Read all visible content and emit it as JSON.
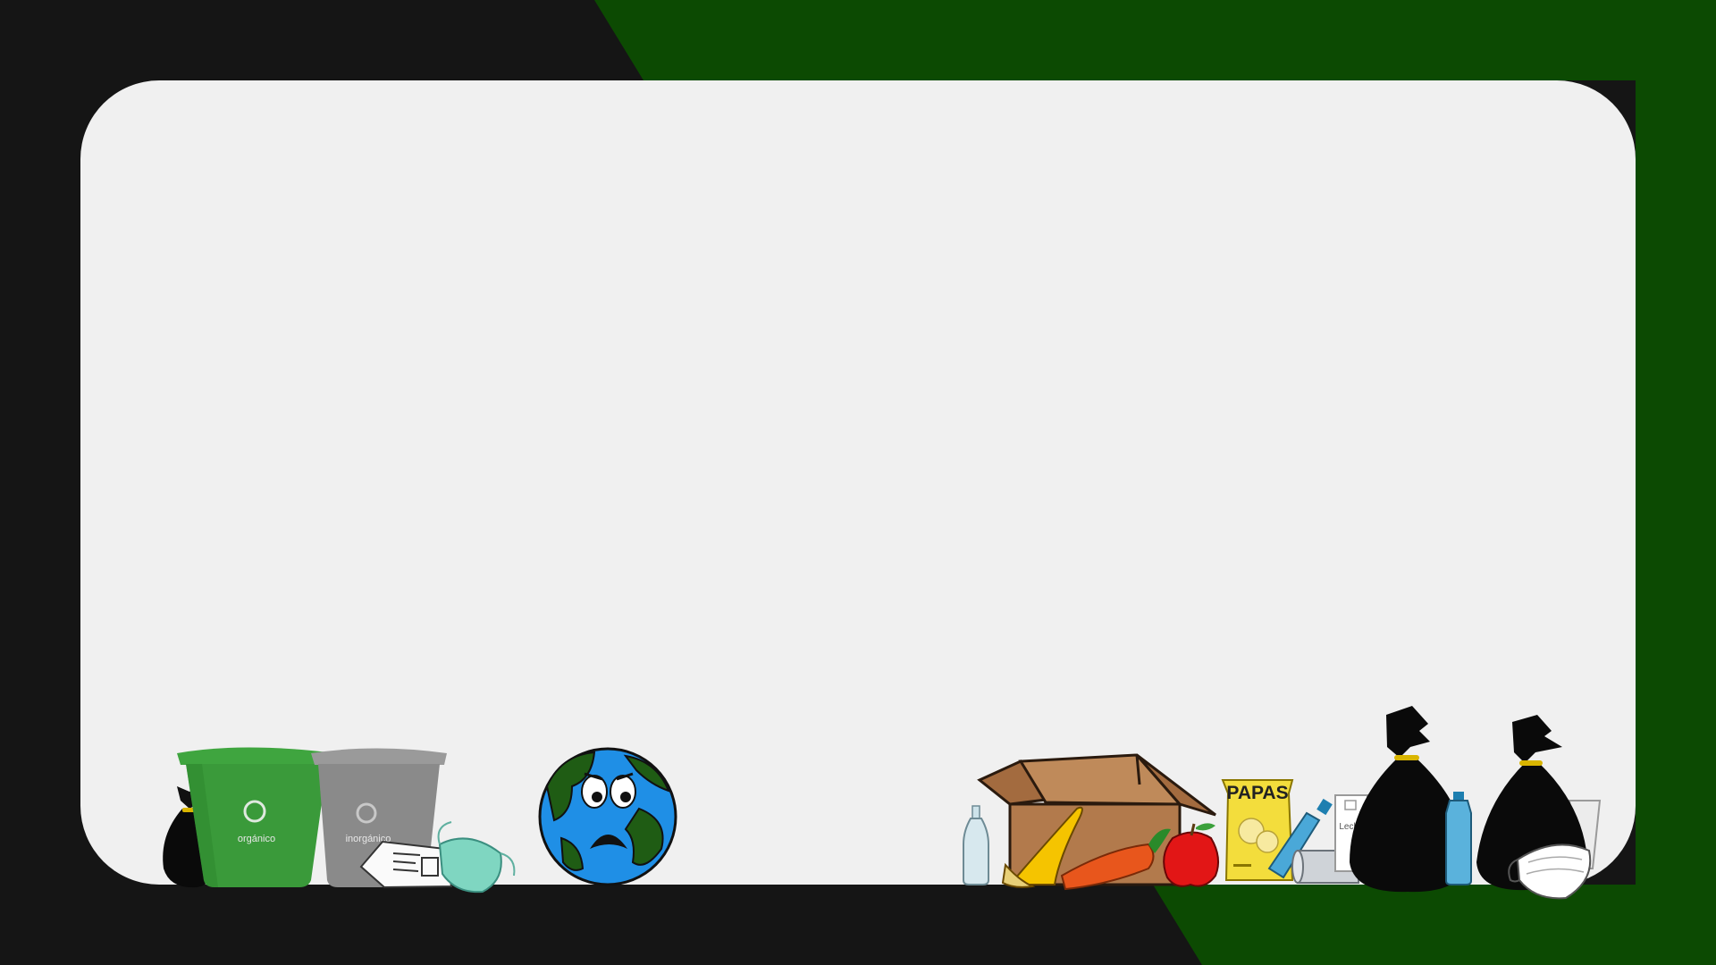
{
  "colors": {
    "background_dark": "#151515",
    "background_green": "#0c4a02",
    "panel": "#f0f0f0",
    "bin_green": "#3a9a3a",
    "bin_gray": "#8a8a8a",
    "earth_ocean": "#1f8fe6",
    "earth_land": "#1f5c14",
    "papas_yellow": "#f3dd3c"
  },
  "labels": {
    "bin_green": "orgánico",
    "bin_gray": "inorgánico",
    "chips_bag": "PAPAS",
    "milk_carton": "Leche"
  },
  "icons": [
    "garbage-bag-icon",
    "green-bin-icon",
    "gray-bin-icon",
    "newspaper-icon",
    "face-mask-icon",
    "sad-earth-icon",
    "glass-bottle-icon",
    "cardboard-box-icon",
    "banana-peel-icon",
    "carrot-icon",
    "apple-icon",
    "chips-bag-icon",
    "plastic-bottle-icon",
    "tin-can-icon",
    "milk-carton-icon",
    "plastic-cup-icon"
  ]
}
